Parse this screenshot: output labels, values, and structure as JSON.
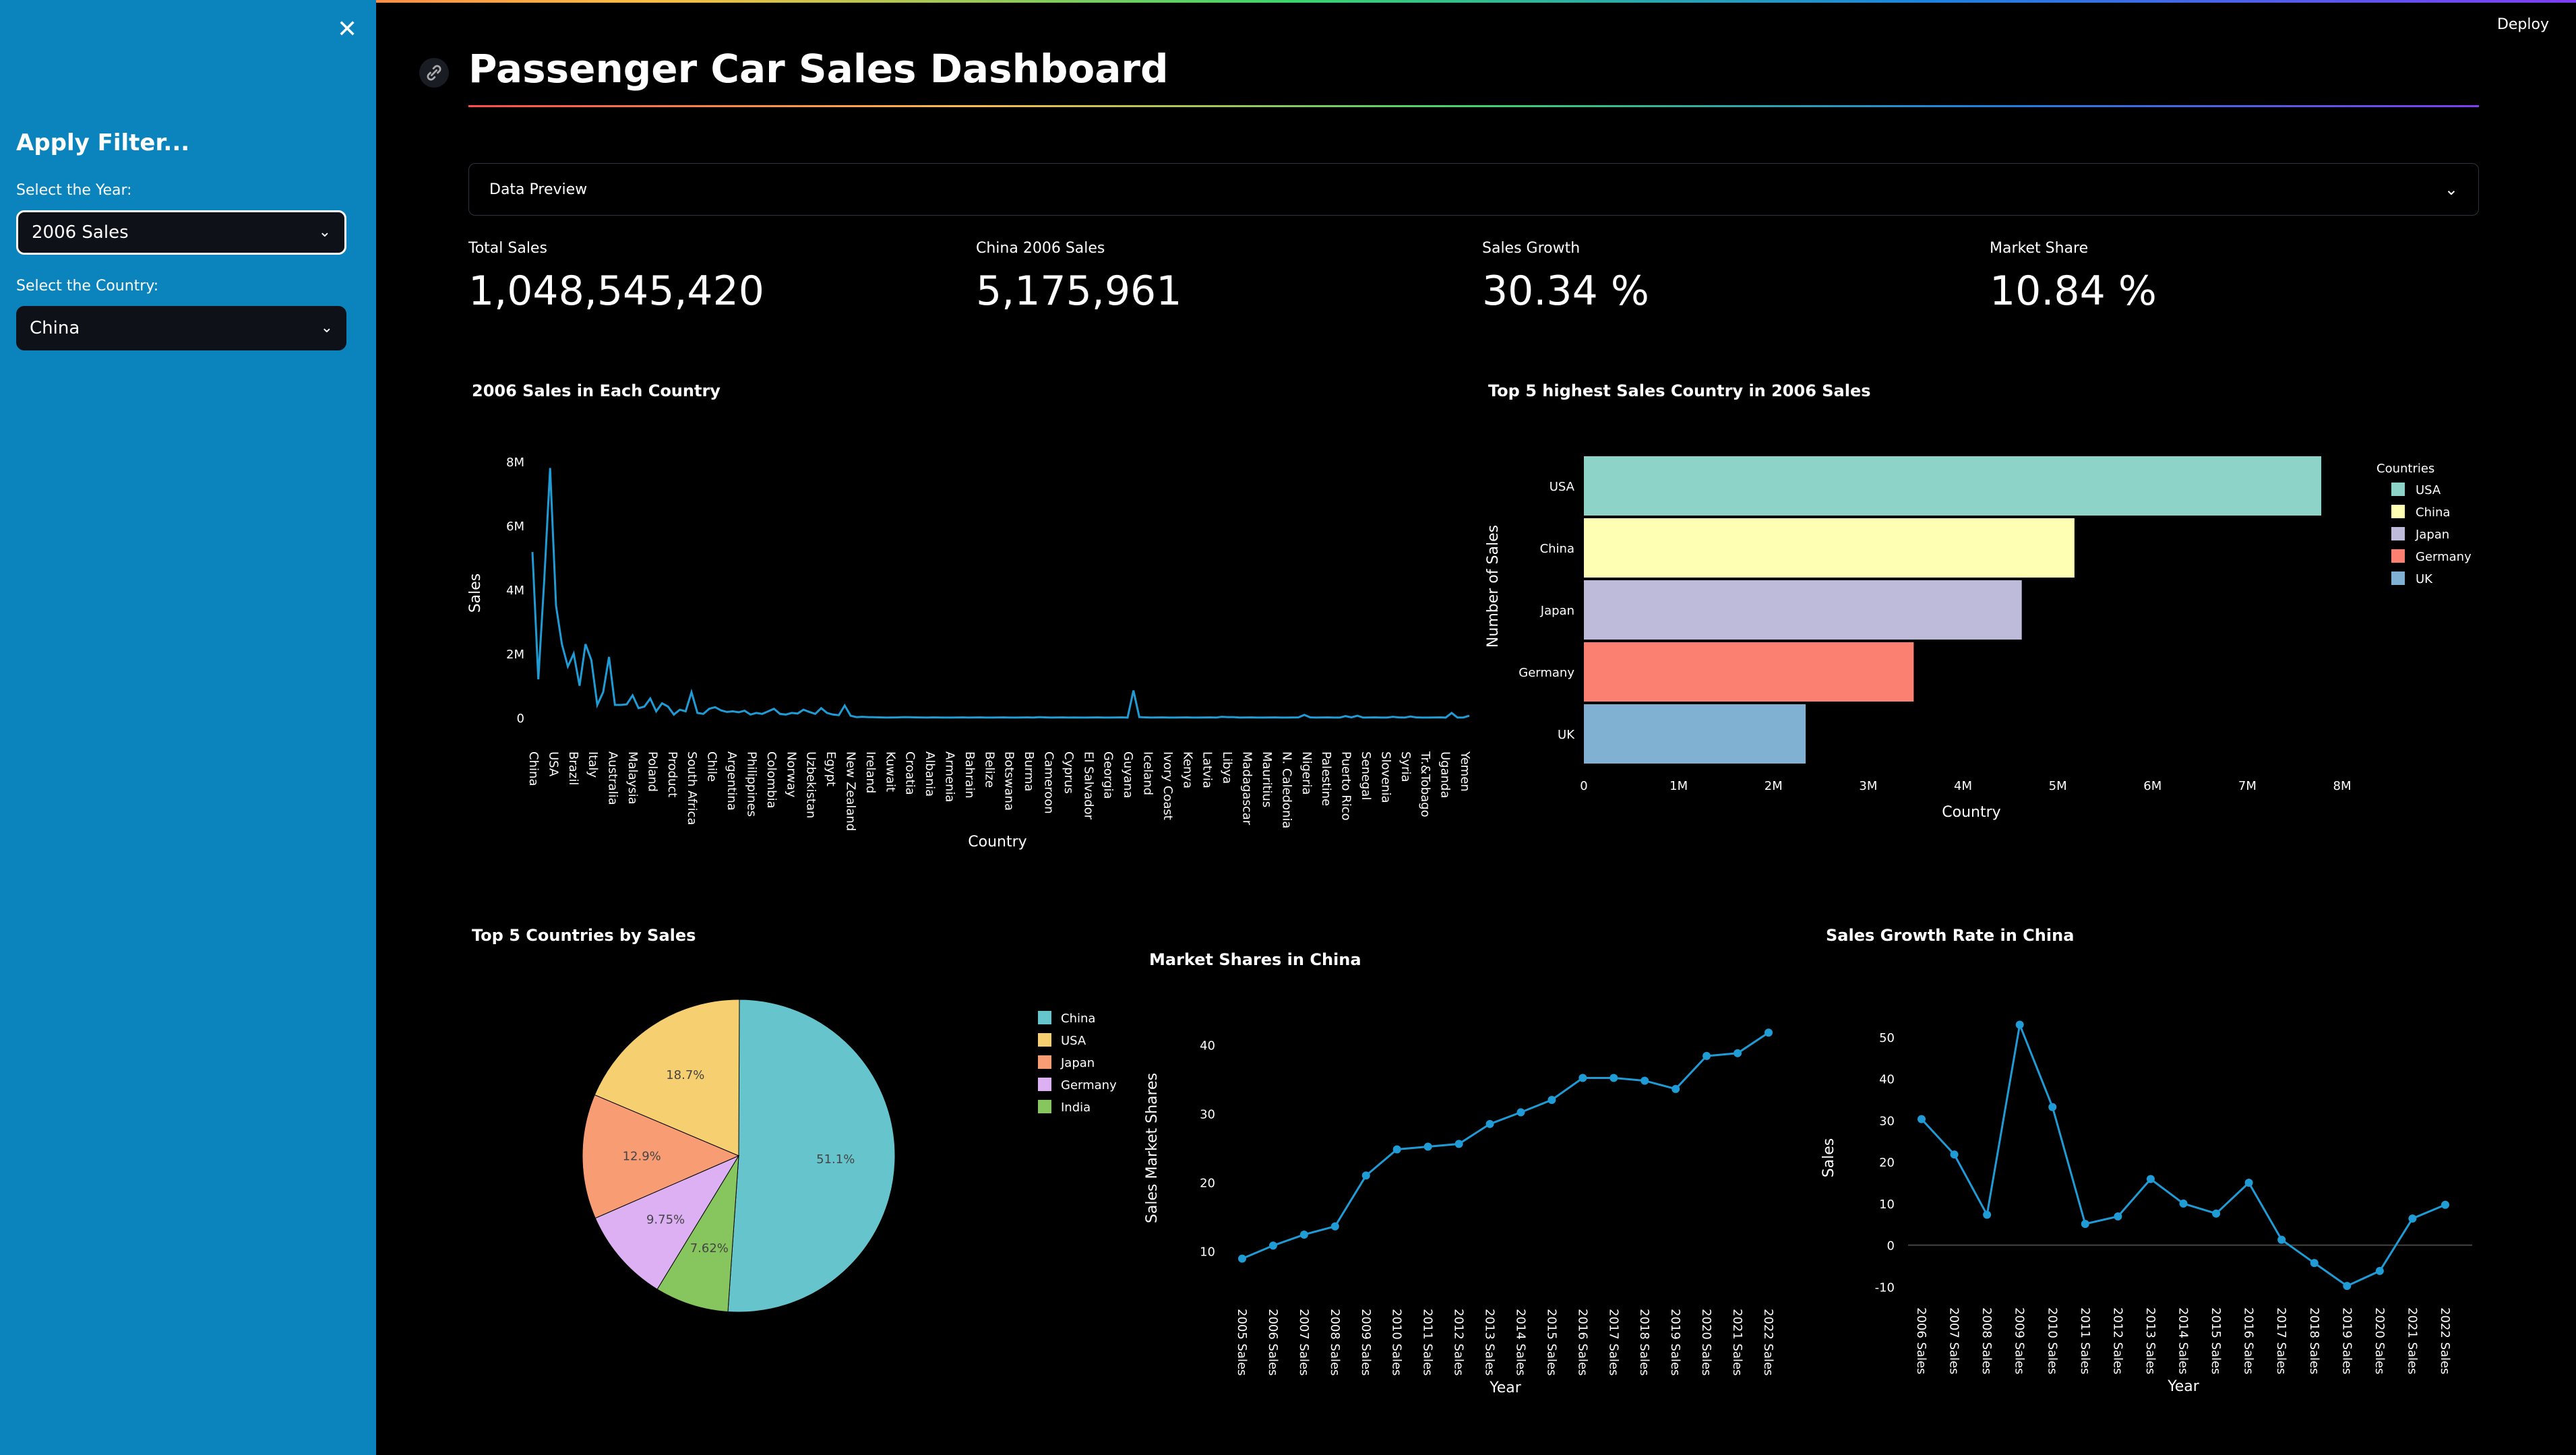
{
  "sidebar": {
    "close_icon": "close-icon",
    "title": "Apply Filter...",
    "year_label": "Select the Year:",
    "year_value": "2006 Sales",
    "country_label": "Select the Country:",
    "country_value": "China"
  },
  "header": {
    "deploy": "Deploy",
    "title": "Passenger Car Sales Dashboard",
    "link_icon": "link-icon"
  },
  "expander": {
    "label": "Data Preview"
  },
  "metrics": [
    {
      "label": "Total Sales",
      "value": "1,048,545,420"
    },
    {
      "label": "China 2006 Sales",
      "value": "5,175,961"
    },
    {
      "label": "Sales Growth",
      "value": "30.34 %"
    },
    {
      "label": "Market Share",
      "value": "10.84 %"
    }
  ],
  "colors": {
    "line": "#1f9bd6",
    "accent_sidebar": "#0b84bd"
  },
  "chart_data": [
    {
      "type": "line",
      "title": "2006 Sales in Each Country",
      "xlabel": "Country",
      "ylabel": "Sales",
      "yticks": [
        "0",
        "2M",
        "4M",
        "6M",
        "8M"
      ],
      "ylim": [
        0,
        8000000
      ],
      "xticks": [
        "China",
        "USA",
        "Brazil",
        "Italy",
        "Australia",
        "Malaysia",
        "Poland",
        "Product",
        "South Africa",
        "Chile",
        "Argentina",
        "Philippines",
        "Colombia",
        "Norway",
        "Uzbekistan",
        "Egypt",
        "New Zealand",
        "Ireland",
        "Kuwait",
        "Croatia",
        "Albania",
        "Armenia",
        "Bahrain",
        "Belize",
        "Botswana",
        "Burma",
        "Cameroon",
        "Cyprus",
        "El Salvador",
        "Georgia",
        "Guyana",
        "Iceland",
        "Ivory Coast",
        "Kenya",
        "Latvia",
        "Libya",
        "Madagascar",
        "Mauritius",
        "N. Caledonia",
        "Nigeria",
        "Palestine",
        "Puerto Rico",
        "Senegal",
        "Slovenia",
        "Syria",
        "Tr.&Tobago",
        "Uganda",
        "Yemen"
      ],
      "values": [
        5175961,
        1200000,
        4300000,
        7800000,
        3500000,
        2300000,
        1600000,
        2000000,
        1000000,
        2300000,
        1800000,
        400000,
        800000,
        1900000,
        400000,
        400000,
        420000,
        700000,
        300000,
        350000,
        600000,
        200000,
        450000,
        350000,
        100000,
        250000,
        200000,
        800000,
        150000,
        120000,
        280000,
        330000,
        230000,
        180000,
        200000,
        170000,
        220000,
        100000,
        150000,
        120000,
        200000,
        280000,
        120000,
        100000,
        150000,
        130000,
        250000,
        180000,
        120000,
        300000,
        150000,
        100000,
        80000,
        380000,
        60000,
        20000,
        30000,
        20000,
        15000,
        10000,
        5000,
        8000,
        10000,
        20000,
        15000,
        10000,
        8000,
        5000,
        10000,
        8000,
        5000,
        5000,
        8000,
        10000,
        5000,
        8000,
        10000,
        5000,
        5000,
        8000,
        10000,
        5000,
        5000,
        8000,
        10000,
        5000,
        20000,
        10000,
        5000,
        8000,
        10000,
        5000,
        8000,
        5000,
        5000,
        8000,
        10000,
        5000,
        5000,
        8000,
        10000,
        5000,
        850000,
        20000,
        10000,
        5000,
        8000,
        10000,
        5000,
        5000,
        8000,
        10000,
        5000,
        5000,
        8000,
        10000,
        5000,
        30000,
        20000,
        20000,
        5000,
        8000,
        10000,
        5000,
        5000,
        8000,
        10000,
        5000,
        5000,
        8000,
        10000,
        90000,
        10000,
        5000,
        8000,
        10000,
        5000,
        5000,
        50000,
        10000,
        60000,
        5000,
        8000,
        10000,
        5000,
        5000,
        30000,
        10000,
        5000,
        40000,
        10000,
        5000,
        5000,
        8000,
        10000,
        5000,
        150000,
        5000,
        8000,
        60000
      ]
    },
    {
      "type": "bar",
      "orientation": "horizontal",
      "title": "Top 5 highest Sales Country in 2006 Sales",
      "xlabel": "Country",
      "ylabel": "Number of Sales",
      "legend_title": "Countries",
      "categories": [
        "USA",
        "China",
        "Japan",
        "Germany",
        "UK"
      ],
      "values": [
        7780000,
        5175961,
        4620000,
        3480000,
        2340000
      ],
      "colors": [
        "#8dd3c7",
        "#ffffb3",
        "#bebada",
        "#fb8072",
        "#80b1d3"
      ],
      "xticks": [
        "0",
        "1M",
        "2M",
        "3M",
        "4M",
        "5M",
        "6M",
        "7M",
        "8M"
      ],
      "xlim": [
        0,
        8000000
      ],
      "legend_position": "right"
    },
    {
      "type": "pie",
      "title": "Top 5 Countries by Sales",
      "labels": [
        "China",
        "USA",
        "Japan",
        "Germany",
        "India"
      ],
      "legend_labels": [
        "China",
        "USA",
        "Japan",
        "Germany",
        "India"
      ],
      "values": [
        51.1,
        18.7,
        12.9,
        9.75,
        7.62
      ],
      "value_labels": [
        "51.1%",
        "18.7%",
        "12.9%",
        "9.75%",
        "7.62%"
      ],
      "slice_order": [
        "China",
        "India",
        "Germany",
        "Japan",
        "USA"
      ],
      "colors": {
        "China": "#66c5cc",
        "USA": "#f6cf71",
        "Japan": "#f89c74",
        "Germany": "#dcb0f2",
        "India": "#87c55f"
      },
      "legend_position": "right"
    },
    {
      "type": "line",
      "title": "Market Shares in China",
      "xlabel": "Year",
      "ylabel": "Sales Market Shares",
      "categories": [
        "2005 Sales",
        "2006 Sales",
        "2007 Sales",
        "2008 Sales",
        "2009 Sales",
        "2010 Sales",
        "2011 Sales",
        "2012 Sales",
        "2013 Sales",
        "2014 Sales",
        "2015 Sales",
        "2016 Sales",
        "2017 Sales",
        "2018 Sales",
        "2019 Sales",
        "2020 Sales",
        "2021 Sales",
        "2022 Sales"
      ],
      "values": [
        8.9,
        10.8,
        12.4,
        13.6,
        21.0,
        24.8,
        25.2,
        25.6,
        28.5,
        30.2,
        32.0,
        35.2,
        35.2,
        34.8,
        33.6,
        38.4,
        38.8,
        41.8
      ],
      "yticks": [
        10,
        20,
        30,
        40
      ],
      "ylim": [
        7,
        43
      ]
    },
    {
      "type": "line",
      "title": "Sales Growth Rate in China",
      "xlabel": "Year",
      "ylabel": "Sales",
      "categories": [
        "2006 Sales",
        "2007 Sales",
        "2008 Sales",
        "2009 Sales",
        "2010 Sales",
        "2011 Sales",
        "2012 Sales",
        "2013 Sales",
        "2014 Sales",
        "2015 Sales",
        "2016 Sales",
        "2017 Sales",
        "2018 Sales",
        "2019 Sales",
        "2020 Sales",
        "2021 Sales",
        "2022 Sales"
      ],
      "values": [
        30.3,
        21.8,
        7.3,
        53.0,
        33.2,
        5.1,
        6.9,
        15.9,
        10.0,
        7.6,
        15.0,
        1.3,
        -4.3,
        -9.8,
        -6.2,
        6.4,
        9.7
      ],
      "yticks": [
        -10,
        0,
        10,
        20,
        30,
        40,
        50
      ],
      "ylim": [
        -14,
        56
      ]
    }
  ]
}
